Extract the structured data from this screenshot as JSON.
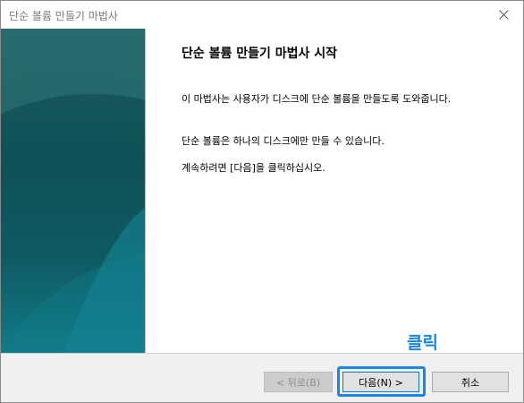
{
  "window": {
    "title": "단순 볼륨 만들기 마법사"
  },
  "content": {
    "heading": "단순 볼륨 만들기 마법사 시작",
    "paragraph1": "이 마법사는 사용자가 디스크에 단순 볼륨을 만들도록 도와줍니다.",
    "paragraph2": "단순 볼륨은 하나의 디스크에만 만들 수 있습니다.",
    "paragraph3": "계속하려면 [다음]을 클릭하십시오."
  },
  "buttons": {
    "back": "< 뒤로(B)",
    "next": "다음(N) >",
    "cancel": "취소"
  },
  "annotation": {
    "click_label": "클릭",
    "color": "#1a86e8"
  },
  "icons": {
    "close": "close-icon"
  }
}
